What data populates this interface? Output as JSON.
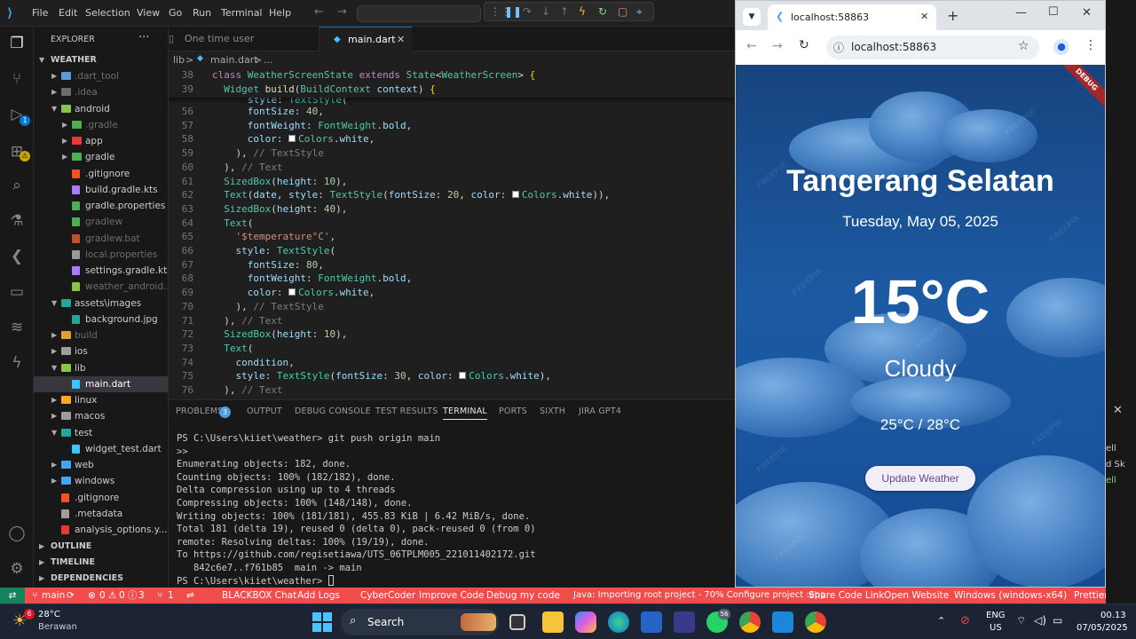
{
  "titlebar": {
    "menu": [
      "File",
      "Edit",
      "Selection",
      "View",
      "Go",
      "Run",
      "Terminal",
      "Help"
    ]
  },
  "sidebar": {
    "header": "EXPLORER",
    "root": "WEATHER",
    "items": [
      {
        "label": ".dart_tool",
        "depth": 1,
        "folder": true,
        "open": false,
        "color": "#5a9bd5",
        "dim": true
      },
      {
        "label": ".idea",
        "depth": 1,
        "folder": true,
        "open": false,
        "color": "#6d6d6d",
        "dim": true
      },
      {
        "label": "android",
        "depth": 1,
        "folder": true,
        "open": true,
        "color": "#8bc34a",
        "dim": false
      },
      {
        "label": ".gradle",
        "depth": 2,
        "folder": true,
        "open": false,
        "color": "#4caf50",
        "dim": true
      },
      {
        "label": "app",
        "depth": 2,
        "folder": true,
        "open": false,
        "color": "#e53935",
        "dim": false
      },
      {
        "label": "gradle",
        "depth": 2,
        "folder": true,
        "open": false,
        "color": "#4caf50",
        "dim": false
      },
      {
        "label": ".gitignore",
        "depth": 2,
        "folder": false,
        "color": "#f4511e",
        "dim": false
      },
      {
        "label": "build.gradle.kts",
        "depth": 2,
        "folder": false,
        "color": "#a97bff",
        "dim": false
      },
      {
        "label": "gradle.properties",
        "depth": 2,
        "folder": false,
        "color": "#4caf50",
        "dim": false
      },
      {
        "label": "gradlew",
        "depth": 2,
        "folder": false,
        "color": "#4caf50",
        "dim": true
      },
      {
        "label": "gradlew.bat",
        "depth": 2,
        "folder": false,
        "color": "#c1502e",
        "dim": true
      },
      {
        "label": "local.properties",
        "depth": 2,
        "folder": false,
        "color": "#999",
        "dim": true
      },
      {
        "label": "settings.gradle.kts",
        "depth": 2,
        "folder": false,
        "color": "#a97bff",
        "dim": false
      },
      {
        "label": "weather_android...",
        "depth": 2,
        "folder": false,
        "color": "#8bc34a",
        "dim": true
      },
      {
        "label": "assets\\images",
        "depth": 1,
        "folder": true,
        "open": true,
        "color": "#26a69a",
        "dim": false
      },
      {
        "label": "background.jpg",
        "depth": 2,
        "folder": false,
        "color": "#26a69a",
        "dim": false
      },
      {
        "label": "build",
        "depth": 1,
        "folder": true,
        "open": false,
        "color": "#e0a030",
        "dim": true
      },
      {
        "label": "ios",
        "depth": 1,
        "folder": true,
        "open": false,
        "color": "#9e9e9e",
        "dim": false
      },
      {
        "label": "lib",
        "depth": 1,
        "folder": true,
        "open": true,
        "color": "#8bc34a",
        "dim": false
      },
      {
        "label": "main.dart",
        "depth": 2,
        "folder": false,
        "color": "#40c4ff",
        "dim": false,
        "selected": true
      },
      {
        "label": "linux",
        "depth": 1,
        "folder": true,
        "open": false,
        "color": "#f9a825",
        "dim": false
      },
      {
        "label": "macos",
        "depth": 1,
        "folder": true,
        "open": false,
        "color": "#9e9e9e",
        "dim": false
      },
      {
        "label": "test",
        "depth": 1,
        "folder": true,
        "open": true,
        "color": "#26a69a",
        "dim": false
      },
      {
        "label": "widget_test.dart",
        "depth": 2,
        "folder": false,
        "color": "#40c4ff",
        "dim": false
      },
      {
        "label": "web",
        "depth": 1,
        "folder": true,
        "open": false,
        "color": "#42a5f5",
        "dim": false
      },
      {
        "label": "windows",
        "depth": 1,
        "folder": true,
        "open": false,
        "color": "#42a5f5",
        "dim": false
      },
      {
        "label": ".gitignore",
        "depth": 1,
        "folder": false,
        "color": "#f4511e",
        "dim": false
      },
      {
        "label": ".metadata",
        "depth": 1,
        "folder": false,
        "color": "#9e9e9e",
        "dim": false
      },
      {
        "label": "analysis_options.y...",
        "depth": 1,
        "folder": false,
        "color": "#e53935",
        "dim": false
      }
    ],
    "sections": [
      "OUTLINE",
      "TIMELINE",
      "DEPENDENCIES"
    ]
  },
  "tabs": [
    {
      "label": "One time user Registeration",
      "active": false
    },
    {
      "label": "main.dart",
      "active": true
    }
  ],
  "breadcrumb": {
    "folder": "lib",
    "sep": ">",
    "file": "main.dart",
    "more": "..."
  },
  "editor": {
    "sticky": [
      {
        "num": "38",
        "html": "<span class=\"k\">class</span> <span class=\"t\">WeatherScreenState</span> <span class=\"k\">extends</span> <span class=\"t\">State</span>&lt;<span class=\"t\">WeatherScreen</span>&gt; <span class=\"y\">{</span>"
      },
      {
        "num": "39",
        "html": "  <span class=\"t\">Widget</span> <span class=\"f\">build</span>(<span class=\"t\">BuildContext</span> <span class=\"p\">context</span>) <span class=\"y\">{</span>"
      }
    ],
    "lines": [
      {
        "num": "56",
        "html": "      <span class=\"p\">fontSize</span>: <span class=\"n\">40</span>,"
      },
      {
        "num": "57",
        "html": "      <span class=\"p\">fontWeight</span>: <span class=\"t\">FontWeight</span>.<span class=\"p\">bold</span>,"
      },
      {
        "num": "58",
        "html": "      <span class=\"p\">color</span>: <span class=\"sw\"></span><span class=\"t\">Colors</span>.<span class=\"p\">white</span>,"
      },
      {
        "num": "59",
        "html": "    ), <span class=\"ct\">// TextStyle</span>"
      },
      {
        "num": "60",
        "html": "  ), <span class=\"ct\">// Text</span>"
      },
      {
        "num": "61",
        "html": "  <span class=\"t\">SizedBox</span>(<span class=\"p\">height</span>: <span class=\"n\">10</span>),"
      },
      {
        "num": "62",
        "html": "  <span class=\"t\">Text</span>(<span class=\"p\">date</span>, <span class=\"p\">style</span>: <span class=\"t\">TextStyle</span>(<span class=\"p\">fontSize</span>: <span class=\"n\">20</span>, <span class=\"p\">color</span>: <span class=\"sw\"></span><span class=\"t\">Colors</span>.<span class=\"p\">white</span>)),"
      },
      {
        "num": "63",
        "html": "  <span class=\"t\">SizedBox</span>(<span class=\"p\">height</span>: <span class=\"n\">40</span>),"
      },
      {
        "num": "64",
        "html": "  <span class=\"t\">Text</span>("
      },
      {
        "num": "65",
        "html": "    <span class=\"s\">'$temperature°C'</span>,"
      },
      {
        "num": "66",
        "html": "    <span class=\"p\">style</span>: <span class=\"t\">TextStyle</span>("
      },
      {
        "num": "67",
        "html": "      <span class=\"p\">fontSize</span>: <span class=\"n\">80</span>,"
      },
      {
        "num": "68",
        "html": "      <span class=\"p\">fontWeight</span>: <span class=\"t\">FontWeight</span>.<span class=\"p\">bold</span>,"
      },
      {
        "num": "69",
        "html": "      <span class=\"p\">color</span>: <span class=\"sw\"></span><span class=\"t\">Colors</span>.<span class=\"p\">white</span>,"
      },
      {
        "num": "70",
        "html": "    ), <span class=\"ct\">// TextStyle</span>"
      },
      {
        "num": "71",
        "html": "  ), <span class=\"ct\">// Text</span>"
      },
      {
        "num": "72",
        "html": "  <span class=\"t\">SizedBox</span>(<span class=\"p\">height</span>: <span class=\"n\">10</span>),"
      },
      {
        "num": "73",
        "html": "  <span class=\"t\">Text</span>("
      },
      {
        "num": "74",
        "html": "    <span class=\"p\">condition</span>,"
      },
      {
        "num": "75",
        "html": "    <span class=\"p\">style</span>: <span class=\"t\">TextStyle</span>(<span class=\"p\">fontSize</span>: <span class=\"n\">30</span>, <span class=\"p\">color</span>: <span class=\"sw\"></span><span class=\"t\">Colors</span>.<span class=\"p\">white</span>),"
      },
      {
        "num": "76",
        "html": "  ), <span class=\"ct\">// Text</span>"
      }
    ]
  },
  "panel": {
    "tabs": [
      "PROBLEMS",
      "OUTPUT",
      "DEBUG CONSOLE",
      "TEST RESULTS",
      "TERMINAL",
      "PORTS",
      "SIXTH",
      "JIRA GPT4"
    ],
    "problems_count": "3",
    "active": "TERMINAL",
    "terminal": [
      "PS C:\\Users\\kiiet\\weather> git push origin main",
      ">>",
      "Enumerating objects: 182, done.",
      "Counting objects: 100% (182/182), done.",
      "Delta compression using up to 4 threads",
      "Compressing objects: 100% (148/148), done.",
      "Writing objects: 100% (181/181), 455.83 KiB | 6.42 MiB/s, done.",
      "Total 181 (delta 19), reused 0 (delta 0), pack-reused 0 (from 0)",
      "remote: Resolving deltas: 100% (19/19), done.",
      "To https://github.com/regisetiawa/UTS_06TPLM005_221011402172.git",
      "   842c6e7..f761b85  main -> main",
      "PS C:\\Users\\kiiet\\weather> "
    ]
  },
  "statusbar": {
    "branch": "main",
    "errors": "0",
    "warnings": "0",
    "info": "3",
    "ports": "1",
    "items": [
      "BLACKBOX Chat",
      "Add Logs",
      "CyberCoder",
      "Improve Code",
      "Debug my code",
      "Java: Importing root project - 70% Configure project :app",
      "Share Code Link",
      "Open Website",
      "Windows (windows-x64)",
      "Prettier"
    ]
  },
  "browser": {
    "tab_title": "localhost:58863",
    "url": "localhost:58863",
    "debug_ribbon": "DEBUG",
    "app": {
      "city": "Tangerang Selatan",
      "date": "Tuesday, May 05, 2025",
      "temperature": "15°C",
      "condition": "Cloudy",
      "range": "25°C / 28°C",
      "button": "Update Weather",
      "watermark": "FREEPIK"
    }
  },
  "taskbar": {
    "weather_temp": "28°C",
    "weather_desc": "Berawan",
    "weather_badge": "6",
    "search_placeholder": "Search",
    "whatsapp_badge": "56",
    "lang1": "ENG",
    "lang2": "US",
    "time": "00.13",
    "date": "07/05/2025"
  },
  "right_peek": {
    "lines": [
      "ell",
      "d Sk",
      "ell"
    ]
  }
}
